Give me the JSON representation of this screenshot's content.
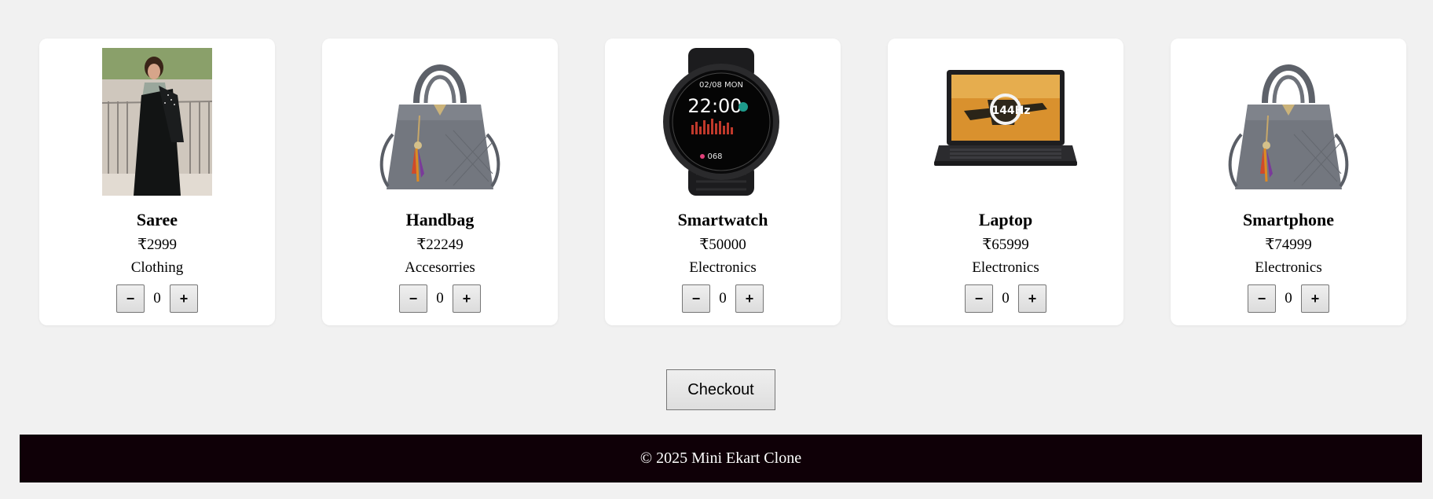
{
  "products": [
    {
      "name": "Saree",
      "price": "₹2999",
      "category": "Clothing",
      "qty": "0",
      "image": "saree-photo"
    },
    {
      "name": "Handbag",
      "price": "₹22249",
      "category": "Accesorries",
      "qty": "0",
      "image": "handbag-photo"
    },
    {
      "name": "Smartwatch",
      "price": "₹50000",
      "category": "Electronics",
      "qty": "0",
      "image": "smartwatch-photo"
    },
    {
      "name": "Laptop",
      "price": "₹65999",
      "category": "Electronics",
      "qty": "0",
      "image": "laptop-photo"
    },
    {
      "name": "Smartphone",
      "price": "₹74999",
      "category": "Electronics",
      "qty": "0",
      "image": "handbag-photo"
    }
  ],
  "controls": {
    "minus": "−",
    "plus": "+"
  },
  "watch_screen": {
    "date": "02/08 MON",
    "time": "22:00",
    "hr": "068"
  },
  "laptop_screen": {
    "badge": "144Hz"
  },
  "checkout": {
    "label": "Checkout"
  },
  "footer": {
    "text": "© 2025 Mini Ekart Clone"
  },
  "colors": {
    "background": "#f1f1f1",
    "card": "#ffffff",
    "footer": "#0f0007"
  }
}
